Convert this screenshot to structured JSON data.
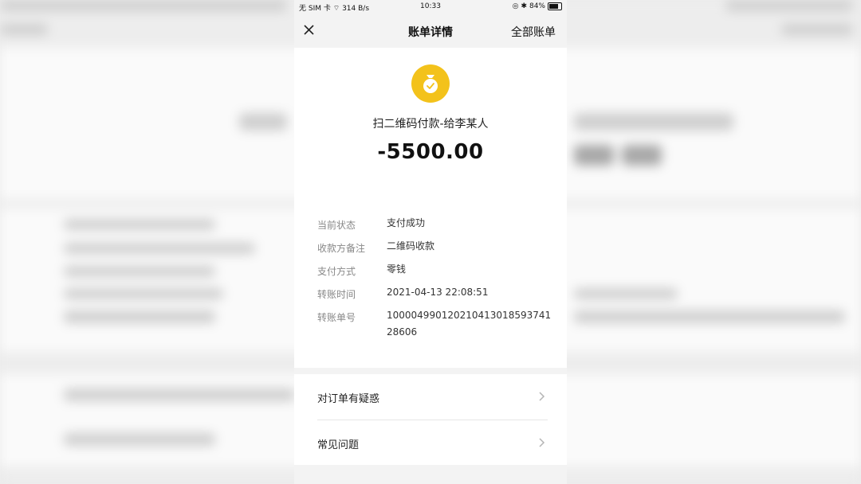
{
  "status_bar": {
    "carrier": "无 SIM 卡",
    "speed": "314 B/s",
    "time": "10:33",
    "battery": "84%"
  },
  "navbar": {
    "close_icon": "close-icon",
    "title": "账单详情",
    "all_bills": "全部账单"
  },
  "summary": {
    "icon": "money-bag-icon",
    "icon_color": "#f3c21b",
    "title": "扫二维码付款-给李某人",
    "amount": "-5500.00"
  },
  "details": [
    {
      "label": "当前状态",
      "value": "支付成功"
    },
    {
      "label": "收款方备注",
      "value": "二维码收款"
    },
    {
      "label": "支付方式",
      "value": "零钱"
    },
    {
      "label": "转账时间",
      "value": "2021-04-13 22:08:51"
    },
    {
      "label": "转账单号",
      "value": "100004990120210413018593741 28606"
    }
  ],
  "links": [
    {
      "label": "对订单有疑惑",
      "icon": "chevron-right-icon"
    },
    {
      "label": "常见问题",
      "icon": "chevron-right-icon"
    }
  ]
}
